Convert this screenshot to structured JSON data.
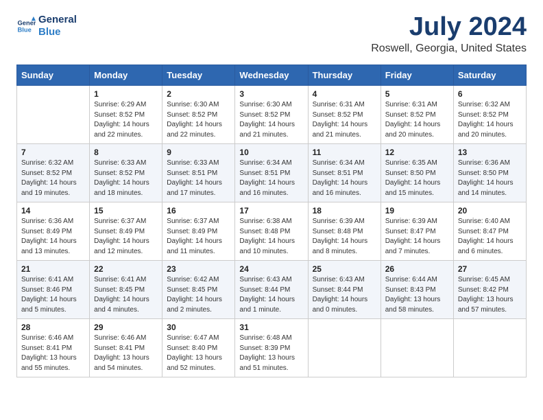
{
  "logo": {
    "line1": "General",
    "line2": "Blue"
  },
  "title": "July 2024",
  "subtitle": "Roswell, Georgia, United States",
  "days_of_week": [
    "Sunday",
    "Monday",
    "Tuesday",
    "Wednesday",
    "Thursday",
    "Friday",
    "Saturday"
  ],
  "weeks": [
    [
      {
        "day": "",
        "info": ""
      },
      {
        "day": "1",
        "info": "Sunrise: 6:29 AM\nSunset: 8:52 PM\nDaylight: 14 hours\nand 22 minutes."
      },
      {
        "day": "2",
        "info": "Sunrise: 6:30 AM\nSunset: 8:52 PM\nDaylight: 14 hours\nand 22 minutes."
      },
      {
        "day": "3",
        "info": "Sunrise: 6:30 AM\nSunset: 8:52 PM\nDaylight: 14 hours\nand 21 minutes."
      },
      {
        "day": "4",
        "info": "Sunrise: 6:31 AM\nSunset: 8:52 PM\nDaylight: 14 hours\nand 21 minutes."
      },
      {
        "day": "5",
        "info": "Sunrise: 6:31 AM\nSunset: 8:52 PM\nDaylight: 14 hours\nand 20 minutes."
      },
      {
        "day": "6",
        "info": "Sunrise: 6:32 AM\nSunset: 8:52 PM\nDaylight: 14 hours\nand 20 minutes."
      }
    ],
    [
      {
        "day": "7",
        "info": "Sunrise: 6:32 AM\nSunset: 8:52 PM\nDaylight: 14 hours\nand 19 minutes."
      },
      {
        "day": "8",
        "info": "Sunrise: 6:33 AM\nSunset: 8:52 PM\nDaylight: 14 hours\nand 18 minutes."
      },
      {
        "day": "9",
        "info": "Sunrise: 6:33 AM\nSunset: 8:51 PM\nDaylight: 14 hours\nand 17 minutes."
      },
      {
        "day": "10",
        "info": "Sunrise: 6:34 AM\nSunset: 8:51 PM\nDaylight: 14 hours\nand 16 minutes."
      },
      {
        "day": "11",
        "info": "Sunrise: 6:34 AM\nSunset: 8:51 PM\nDaylight: 14 hours\nand 16 minutes."
      },
      {
        "day": "12",
        "info": "Sunrise: 6:35 AM\nSunset: 8:50 PM\nDaylight: 14 hours\nand 15 minutes."
      },
      {
        "day": "13",
        "info": "Sunrise: 6:36 AM\nSunset: 8:50 PM\nDaylight: 14 hours\nand 14 minutes."
      }
    ],
    [
      {
        "day": "14",
        "info": "Sunrise: 6:36 AM\nSunset: 8:49 PM\nDaylight: 14 hours\nand 13 minutes."
      },
      {
        "day": "15",
        "info": "Sunrise: 6:37 AM\nSunset: 8:49 PM\nDaylight: 14 hours\nand 12 minutes."
      },
      {
        "day": "16",
        "info": "Sunrise: 6:37 AM\nSunset: 8:49 PM\nDaylight: 14 hours\nand 11 minutes."
      },
      {
        "day": "17",
        "info": "Sunrise: 6:38 AM\nSunset: 8:48 PM\nDaylight: 14 hours\nand 10 minutes."
      },
      {
        "day": "18",
        "info": "Sunrise: 6:39 AM\nSunset: 8:48 PM\nDaylight: 14 hours\nand 8 minutes."
      },
      {
        "day": "19",
        "info": "Sunrise: 6:39 AM\nSunset: 8:47 PM\nDaylight: 14 hours\nand 7 minutes."
      },
      {
        "day": "20",
        "info": "Sunrise: 6:40 AM\nSunset: 8:47 PM\nDaylight: 14 hours\nand 6 minutes."
      }
    ],
    [
      {
        "day": "21",
        "info": "Sunrise: 6:41 AM\nSunset: 8:46 PM\nDaylight: 14 hours\nand 5 minutes."
      },
      {
        "day": "22",
        "info": "Sunrise: 6:41 AM\nSunset: 8:45 PM\nDaylight: 14 hours\nand 4 minutes."
      },
      {
        "day": "23",
        "info": "Sunrise: 6:42 AM\nSunset: 8:45 PM\nDaylight: 14 hours\nand 2 minutes."
      },
      {
        "day": "24",
        "info": "Sunrise: 6:43 AM\nSunset: 8:44 PM\nDaylight: 14 hours\nand 1 minute."
      },
      {
        "day": "25",
        "info": "Sunrise: 6:43 AM\nSunset: 8:44 PM\nDaylight: 14 hours\nand 0 minutes."
      },
      {
        "day": "26",
        "info": "Sunrise: 6:44 AM\nSunset: 8:43 PM\nDaylight: 13 hours\nand 58 minutes."
      },
      {
        "day": "27",
        "info": "Sunrise: 6:45 AM\nSunset: 8:42 PM\nDaylight: 13 hours\nand 57 minutes."
      }
    ],
    [
      {
        "day": "28",
        "info": "Sunrise: 6:46 AM\nSunset: 8:41 PM\nDaylight: 13 hours\nand 55 minutes."
      },
      {
        "day": "29",
        "info": "Sunrise: 6:46 AM\nSunset: 8:41 PM\nDaylight: 13 hours\nand 54 minutes."
      },
      {
        "day": "30",
        "info": "Sunrise: 6:47 AM\nSunset: 8:40 PM\nDaylight: 13 hours\nand 52 minutes."
      },
      {
        "day": "31",
        "info": "Sunrise: 6:48 AM\nSunset: 8:39 PM\nDaylight: 13 hours\nand 51 minutes."
      },
      {
        "day": "",
        "info": ""
      },
      {
        "day": "",
        "info": ""
      },
      {
        "day": "",
        "info": ""
      }
    ]
  ]
}
